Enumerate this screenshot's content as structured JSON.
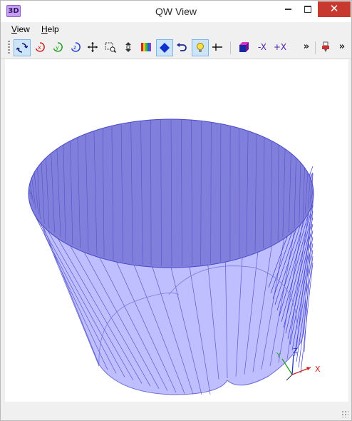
{
  "window": {
    "title": "QW View",
    "app_icon_label": "3D",
    "close_glyph": "✕"
  },
  "menu": {
    "items": [
      {
        "label_first": "V",
        "label_rest": "iew"
      },
      {
        "label_first": "H",
        "label_rest": "elp"
      }
    ]
  },
  "toolbar": {
    "buttons": [
      {
        "name": "rotate-icon",
        "active": true
      },
      {
        "name": "rotate-x-icon",
        "glyph": "x",
        "color": "#d02020"
      },
      {
        "name": "rotate-y-icon",
        "glyph": "y",
        "color": "#20a020"
      },
      {
        "name": "rotate-z-icon",
        "glyph": "z",
        "color": "#2040d0"
      },
      {
        "name": "pan-icon"
      },
      {
        "name": "zoom-window-icon"
      },
      {
        "name": "zoom-icon"
      },
      {
        "name": "color-map-icon"
      },
      {
        "name": "solid-shading-icon",
        "active": true
      },
      {
        "name": "undo-icon"
      },
      {
        "name": "light-icon",
        "active": true
      },
      {
        "name": "axis-cross-icon"
      },
      {
        "name": "cube-view-icon"
      },
      {
        "name": "minus-x-view-icon",
        "label": "-X"
      },
      {
        "name": "plus-x-view-icon",
        "label": "+X"
      },
      {
        "name": "overflow-chevron-icon",
        "label": "»"
      },
      {
        "name": "print-pin-icon"
      },
      {
        "name": "overflow-chevron-2-icon",
        "label": "»"
      }
    ]
  },
  "scene": {
    "top_face_color": "#8080dc",
    "side_color": "#b4b4ff",
    "edge_color": "#4a4ac8"
  },
  "axes": {
    "x_label": "X",
    "y_label": "Y",
    "z_label": "Z",
    "x_color": "#d02020",
    "y_color": "#20a020",
    "z_color": "#2030c0"
  }
}
